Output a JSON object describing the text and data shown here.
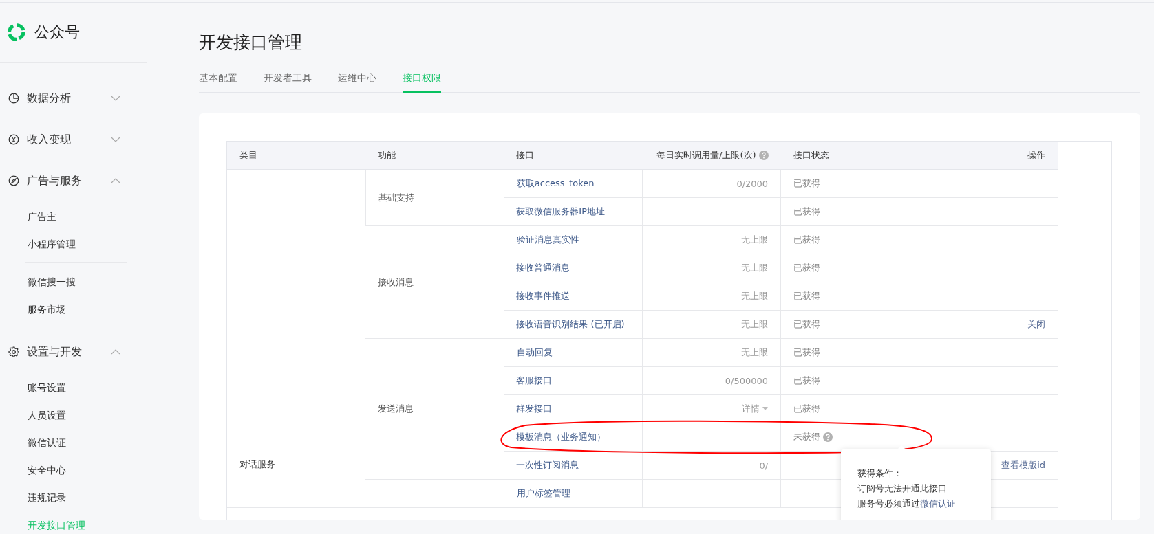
{
  "sidebar": {
    "brand": "公众号",
    "sections": [
      {
        "label": "数据分析",
        "expanded": false
      },
      {
        "label": "收入变现",
        "expanded": false
      },
      {
        "label": "广告与服务",
        "expanded": true,
        "groups": [
          [
            {
              "label": "广告主",
              "selected": false
            },
            {
              "label": "小程序管理",
              "selected": false
            }
          ],
          [
            {
              "label": "微信搜一搜",
              "selected": false
            },
            {
              "label": "服务市场",
              "selected": false
            }
          ]
        ]
      },
      {
        "label": "设置与开发",
        "expanded": true,
        "groups": [
          [
            {
              "label": "账号设置",
              "selected": false
            },
            {
              "label": "人员设置",
              "selected": false
            },
            {
              "label": "微信认证",
              "selected": false
            },
            {
              "label": "安全中心",
              "selected": false
            },
            {
              "label": "违规记录",
              "selected": false
            },
            {
              "label": "开发接口管理",
              "selected": true
            }
          ]
        ]
      }
    ]
  },
  "page": {
    "title": "开发接口管理",
    "tabs": [
      {
        "label": "基本配置",
        "selected": false
      },
      {
        "label": "开发者工具",
        "selected": false
      },
      {
        "label": "运维中心",
        "selected": false
      },
      {
        "label": "接口权限",
        "selected": true
      }
    ]
  },
  "table": {
    "columns": [
      {
        "label": "类目",
        "help": false
      },
      {
        "label": "功能",
        "help": false
      },
      {
        "label": "接口",
        "help": false
      },
      {
        "label": "每日实时调用量/上限(次)",
        "help": true
      },
      {
        "label": "接口状态",
        "help": false
      },
      {
        "label": "操作",
        "help": false
      }
    ],
    "categories": [
      {
        "label": "对话服务",
        "groups": [
          {
            "label": "基础支持",
            "rows": [
              {
                "name": "获取access_token",
                "count": "0/2000",
                "count_dropdown": false,
                "status": "已获得",
                "status_help": false
              },
              {
                "name": "获取微信服务器IP地址",
                "count_dropdown": false,
                "status": "已获得",
                "status_help": false
              }
            ]
          },
          {
            "label": "接收消息",
            "rows": [
              {
                "name": "验证消息真实性",
                "count": "无上限",
                "count_dropdown": false,
                "status": "已获得",
                "status_help": false
              },
              {
                "name": "接收普通消息",
                "count": "无上限",
                "count_dropdown": false,
                "status": "已获得",
                "status_help": false
              },
              {
                "name": "接收事件推送",
                "count": "无上限",
                "count_dropdown": false,
                "status": "已获得",
                "status_help": false
              },
              {
                "name": "接收语音识别结果 (已开启)",
                "count": "无上限",
                "count_dropdown": false,
                "status": "已获得",
                "status_help": false,
                "action": "关闭"
              }
            ]
          },
          {
            "label": "发送消息",
            "rows": [
              {
                "name": "自动回复",
                "count": "无上限",
                "count_dropdown": false,
                "status": "已获得",
                "status_help": false
              },
              {
                "name": "客服接口",
                "count": "0/500000",
                "count_dropdown": false,
                "status": "已获得",
                "status_help": false
              },
              {
                "name": "群发接口",
                "count": "详情",
                "count_dropdown": true,
                "status": "已获得",
                "status_help": false
              },
              {
                "name": "模板消息（业务通知）",
                "count_dropdown": false,
                "status": "未获得",
                "status_help": true
              },
              {
                "name": "一次性订阅消息",
                "count": "0/",
                "count_dropdown": false,
                "status_help": false,
                "action": "查看模版id"
              }
            ]
          },
          {
            "rows": [
              {
                "name": "用户标签管理",
                "count_dropdown": false,
                "status_help": false
              }
            ]
          }
        ]
      }
    ]
  },
  "tooltip": {
    "title": "获得条件：",
    "lines": [
      {
        "text": "订阅号无法开通此接口"
      },
      {
        "text": "服务号必须通过",
        "link": "微信认证"
      }
    ]
  }
}
